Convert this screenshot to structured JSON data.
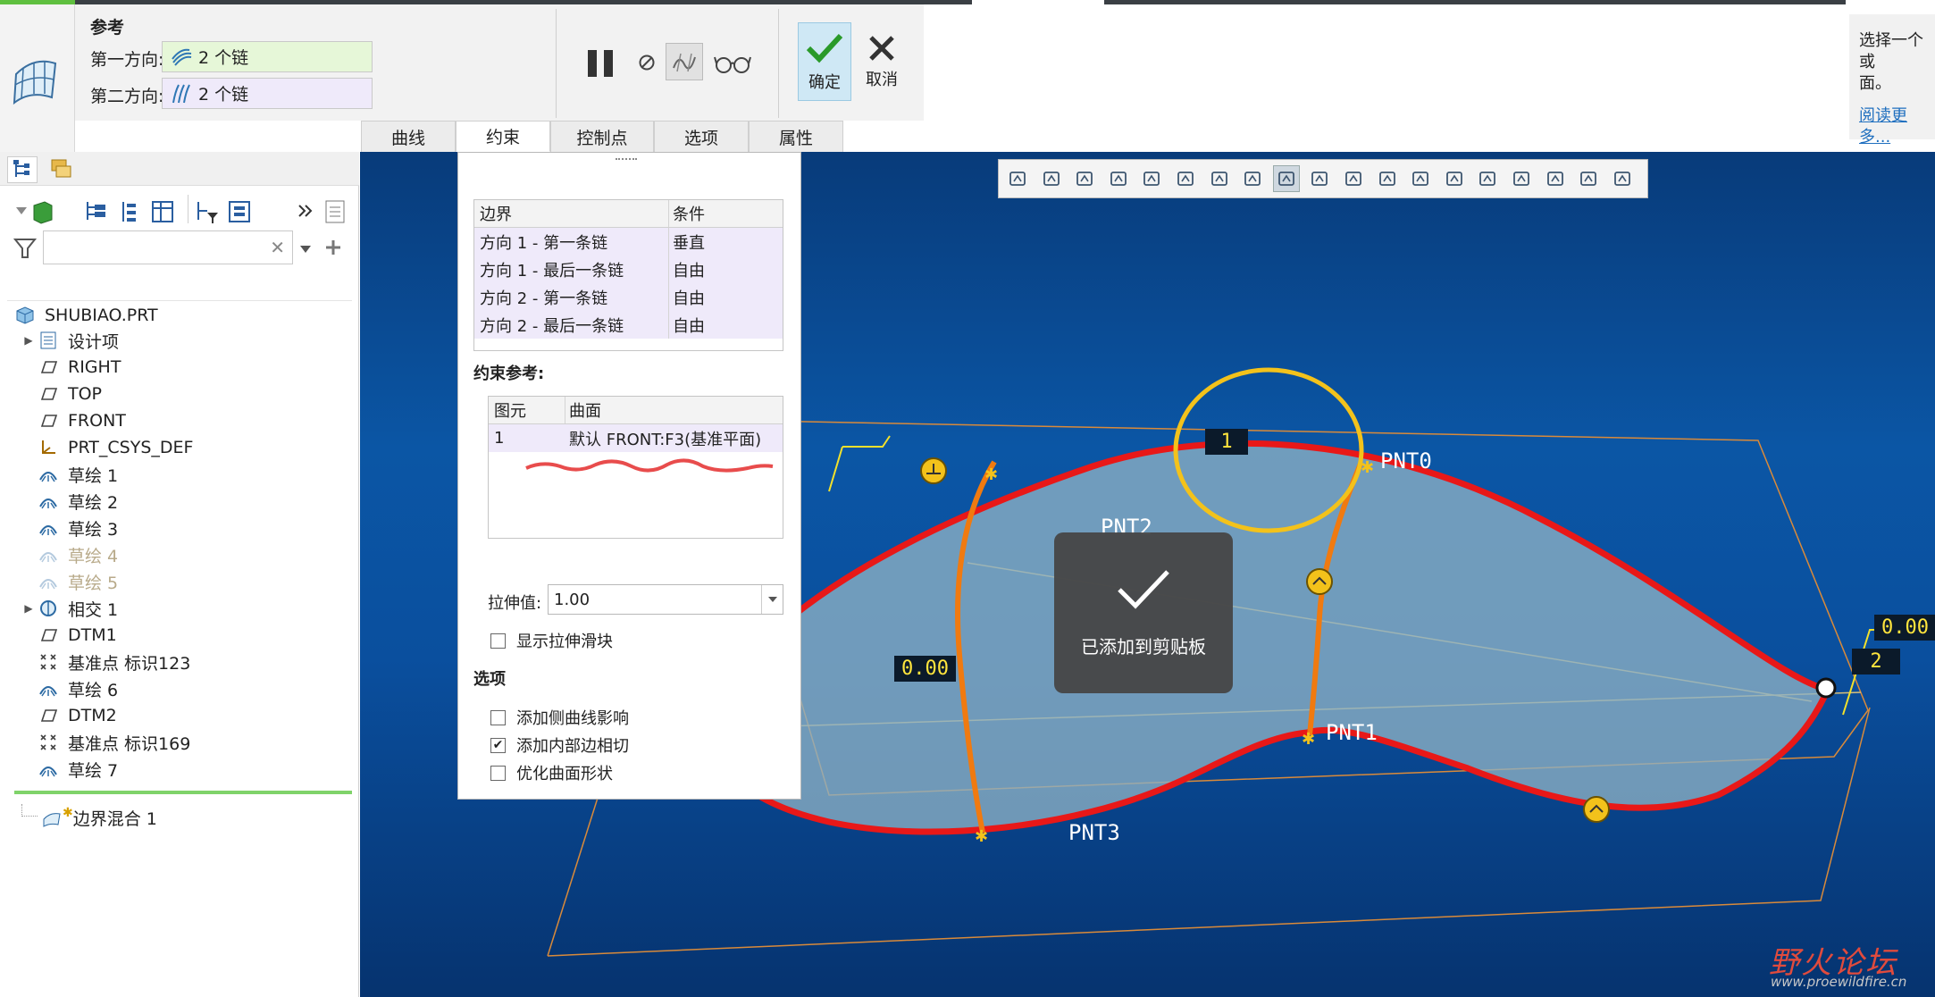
{
  "dashboard": {
    "references_label": "参考",
    "first_direction_label": "第一方向:",
    "first_direction_value": "2 个链",
    "second_direction_label": "第二方向:",
    "second_direction_value": "2 个链",
    "ok_label": "确定",
    "cancel_label": "取消",
    "tabs": [
      {
        "label": "曲线"
      },
      {
        "label": "约束"
      },
      {
        "label": "控制点"
      },
      {
        "label": "选项"
      },
      {
        "label": "属性"
      }
    ],
    "active_tab": "约束"
  },
  "hint_panel": {
    "text_line1": "选择一个或",
    "text_line2": "面。",
    "link": "阅读更多..."
  },
  "model_tree": {
    "root": "SHUBIAO.PRT",
    "items": [
      {
        "label": "设计项",
        "icon": "design-items-icon",
        "expandable": true,
        "dim": false
      },
      {
        "label": "RIGHT",
        "icon": "datum-plane-icon",
        "expandable": false,
        "dim": false
      },
      {
        "label": "TOP",
        "icon": "datum-plane-icon",
        "expandable": false,
        "dim": false
      },
      {
        "label": "FRONT",
        "icon": "datum-plane-icon",
        "expandable": false,
        "dim": false
      },
      {
        "label": "PRT_CSYS_DEF",
        "icon": "csys-icon",
        "expandable": false,
        "dim": false
      },
      {
        "label": "草绘 1",
        "icon": "sketch-icon",
        "expandable": false,
        "dim": false
      },
      {
        "label": "草绘 2",
        "icon": "sketch-icon",
        "expandable": false,
        "dim": false
      },
      {
        "label": "草绘 3",
        "icon": "sketch-icon",
        "expandable": false,
        "dim": false
      },
      {
        "label": "草绘 4",
        "icon": "sketch-icon",
        "expandable": false,
        "dim": true
      },
      {
        "label": "草绘 5",
        "icon": "sketch-icon",
        "expandable": false,
        "dim": true
      },
      {
        "label": "相交 1",
        "icon": "intersect-icon",
        "expandable": true,
        "dim": false
      },
      {
        "label": "DTM1",
        "icon": "datum-plane-icon",
        "expandable": false,
        "dim": false
      },
      {
        "label": "基准点 标识123",
        "icon": "datum-point-icon",
        "expandable": false,
        "dim": false
      },
      {
        "label": "草绘 6",
        "icon": "sketch-icon",
        "expandable": false,
        "dim": false
      },
      {
        "label": "DTM2",
        "icon": "datum-plane-icon",
        "expandable": false,
        "dim": false
      },
      {
        "label": "基准点 标识169",
        "icon": "datum-point-icon",
        "expandable": false,
        "dim": false
      },
      {
        "label": "草绘 7",
        "icon": "sketch-icon",
        "expandable": false,
        "dim": false
      }
    ],
    "active_feature": "边界混合 1"
  },
  "constraints": {
    "table_headers": [
      "边界",
      "条件"
    ],
    "rows": [
      {
        "boundary": "方向 1 - 第一条链",
        "condition": "垂直"
      },
      {
        "boundary": "方向 1 - 最后一条链",
        "condition": "自由"
      },
      {
        "boundary": "方向 2 - 第一条链",
        "condition": "自由"
      },
      {
        "boundary": "方向 2 - 最后一条链",
        "condition": "自由"
      }
    ],
    "ref_label": "约束参考:",
    "ref_headers": [
      "图元",
      "曲面"
    ],
    "ref_rows": [
      {
        "element": "1",
        "surface": "默认 FRONT:F3(基准平面)"
      }
    ],
    "stretch_label": "拉伸值:",
    "stretch_value": "1.00",
    "show_slider_label": "显示拉伸滑块",
    "show_slider_checked": false,
    "options_label": "选项",
    "options": [
      {
        "label": "添加侧曲线影响",
        "checked": false
      },
      {
        "label": "添加内部边相切",
        "checked": true
      },
      {
        "label": "优化曲面形状",
        "checked": false
      }
    ]
  },
  "viewport": {
    "labels": {
      "pnt0": "PNT0",
      "pnt1": "PNT1",
      "pnt2": "PNT2",
      "pnt3": "PNT3",
      "dim_left": "0.00",
      "dim_right": "0.00",
      "tag_1": "1",
      "tag_2": "2"
    },
    "colors": {
      "boundary": "#e81818",
      "internal_curve": "#f07a10",
      "marker": "#f3c21b",
      "highlight_circle": "#f3c21b"
    }
  },
  "toast": {
    "text": "已添加到剪贴板"
  },
  "watermark": {
    "brand": "野火论坛",
    "url": "www.proewildfire.cn"
  }
}
